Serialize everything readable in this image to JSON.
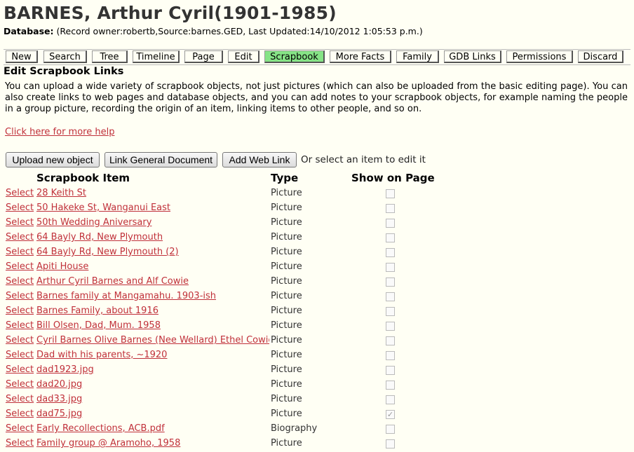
{
  "header": {
    "title": "BARNES, Arthur Cyril(1901-1985)",
    "db_label": "Database:",
    "db_info": "(Record owner:robertb,Source:barnes.GED, Last Updated:14/10/2012 1:05:53 p.m.)"
  },
  "tabs": [
    {
      "label": "New"
    },
    {
      "label": "Search"
    },
    {
      "label": "Tree"
    },
    {
      "label": "Timeline"
    },
    {
      "label": "Page"
    },
    {
      "label": "Edit"
    },
    {
      "label": "Scrapbook",
      "active": true
    },
    {
      "label": "More Facts"
    },
    {
      "label": "Family"
    },
    {
      "label": "GDB Links"
    },
    {
      "label": "Permissions"
    },
    {
      "label": "Discard"
    }
  ],
  "section": {
    "heading": "Edit Scrapbook Links",
    "description": "You can upload a wide variety of scrapbook objects, not just pictures (which can also be uploaded from the basic editing page). You can also create links to web pages and database objects, and you can add notes to your scrapbook objects, for example naming the people in a group picture, recording the origin of an item, linking items to other people, and so on.",
    "help_link": "Click here for more help"
  },
  "actions": {
    "upload": "Upload new object",
    "link_doc": "Link General Document",
    "web_link": "Add Web Link",
    "or_text": "Or select an item to edit it"
  },
  "table": {
    "headers": {
      "item": "Scrapbook Item",
      "type": "Type",
      "show": "Show on Page"
    },
    "select_label": "Select",
    "rows": [
      {
        "item": "28 Keith St",
        "type": "Picture",
        "show": false
      },
      {
        "item": "50 Hakeke St, Wanganui East",
        "type": "Picture",
        "show": false
      },
      {
        "item": "50th Wedding Aniversary",
        "type": "Picture",
        "show": false
      },
      {
        "item": "64 Bayly Rd, New Plymouth",
        "type": "Picture",
        "show": false
      },
      {
        "item": "64 Bayly Rd, New Plymouth (2)",
        "type": "Picture",
        "show": false
      },
      {
        "item": "Apiti House",
        "type": "Picture",
        "show": false
      },
      {
        "item": "Arthur Cyril Barnes and Alf Cowie",
        "type": "Picture",
        "show": false
      },
      {
        "item": "Barnes family at Mangamahu. 1903-ish",
        "type": "Picture",
        "show": false
      },
      {
        "item": "Barnes Family, about 1916",
        "type": "Picture",
        "show": false
      },
      {
        "item": "Bill Olsen, Dad, Mum. 1958",
        "type": "Picture",
        "show": false
      },
      {
        "item": "Cyril Barnes Olive Barnes (Nee Wellard) Ethel Cowie",
        "type": "Picture",
        "show": false
      },
      {
        "item": "Dad with his parents, ~1920",
        "type": "Picture",
        "show": false
      },
      {
        "item": "dad1923.jpg",
        "type": "Picture",
        "show": false
      },
      {
        "item": "dad20.jpg",
        "type": "Picture",
        "show": false
      },
      {
        "item": "dad33.jpg",
        "type": "Picture",
        "show": false
      },
      {
        "item": "dad75.jpg",
        "type": "Picture",
        "show": true
      },
      {
        "item": "Early Recollections, ACB.pdf",
        "type": "Biography",
        "show": false
      },
      {
        "item": "Family group @ Aramoho, 1958",
        "type": "Picture",
        "show": false
      }
    ]
  }
}
